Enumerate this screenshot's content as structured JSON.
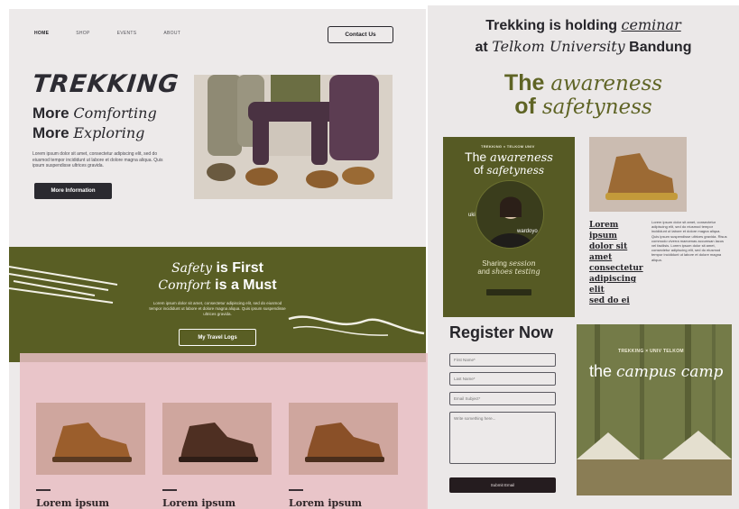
{
  "nav": {
    "items": [
      {
        "label": "HOME",
        "active": true
      },
      {
        "label": "SHOP",
        "active": false
      },
      {
        "label": "EVENTS",
        "active": false
      },
      {
        "label": "ABOUT",
        "active": false
      }
    ],
    "contact_label": "Contact Us"
  },
  "hero": {
    "logo": "TREKKING",
    "line1_bold": "More",
    "line1_italic": "Comforting",
    "line2_bold": "More",
    "line2_italic": "Exploring",
    "paragraph": "Lorem ipsum dolor sit amet, consectetur adipiscing elit, sed do eiusmod tempor incididunt ut labore et dolore magna aliqua. Quis ipsum suspendisse ultrices gravida.",
    "button_label": "More Information"
  },
  "olive": {
    "line1_italic": "Safety",
    "line1_bold": "is First",
    "line2_italic": "Comfort",
    "line2_bold": "is a Must",
    "paragraph": "Lorem ipsum dolor sit amet, consectetur adipiscing elit, sed do eiusmod tempor incididunt ut labore et dolore magna aliqua. Quis ipsum suspendisse ultrices gravida.",
    "button_label": "My Travel Logs"
  },
  "products": [
    {
      "name": "Lorem ipsum"
    },
    {
      "name": "Lorem ipsum"
    },
    {
      "name": "Lorem ipsum"
    }
  ],
  "right": {
    "title1_bold": "Trekking is holding",
    "title1_italic": "ceminar",
    "title2_pre": "at",
    "title2_italic": "Telkom University",
    "title2_post": "Bandung",
    "aware1_bold": "The",
    "aware1_italic": "awareness",
    "aware2_bold": "of",
    "aware2_italic": "safetyness",
    "poster": {
      "tag": "TREKKING × TELKOM UNIV",
      "t1_plain": "The",
      "t1_italic": "awareness",
      "t2_plain": "of",
      "t2_italic": "safetyness",
      "name_left": "uki",
      "name_right": "wardoyo",
      "sub1_plain": "Sharing",
      "sub1_italic": "session",
      "sub2_plain": "and",
      "sub2_italic": "shoes testing"
    },
    "lorem_heading": [
      "Lorem ipsum",
      "dolor sit amet",
      "consectetur",
      "adipiscing elit",
      "sed do ei"
    ],
    "lorem_paragraph": "Lorem ipsum dolor sit amet, consectetur adipiscing elit, sed do eiusmod tempor incididunt ut labore et dolore magna aliqua. Quis ipsum suspendisse ultrices gravida. Risus commodo viverra maecenas accumsan lacus vel facilisis. Lorem ipsum dolor sit amet, consectetur adipiscing elit, sed do eiusmod tempor incididunt ut labore et dolore magna aliqua.",
    "register": {
      "title": "Register Now",
      "first_name": "First Name*",
      "last_name": "Last Name*",
      "email": "Email Subject*",
      "message": "Write something here...",
      "submit": "Submit Email"
    },
    "camp": {
      "tag": "TREKKING × UNIV TELKOM",
      "title_plain": "the",
      "title_italic": "campus camp"
    }
  }
}
